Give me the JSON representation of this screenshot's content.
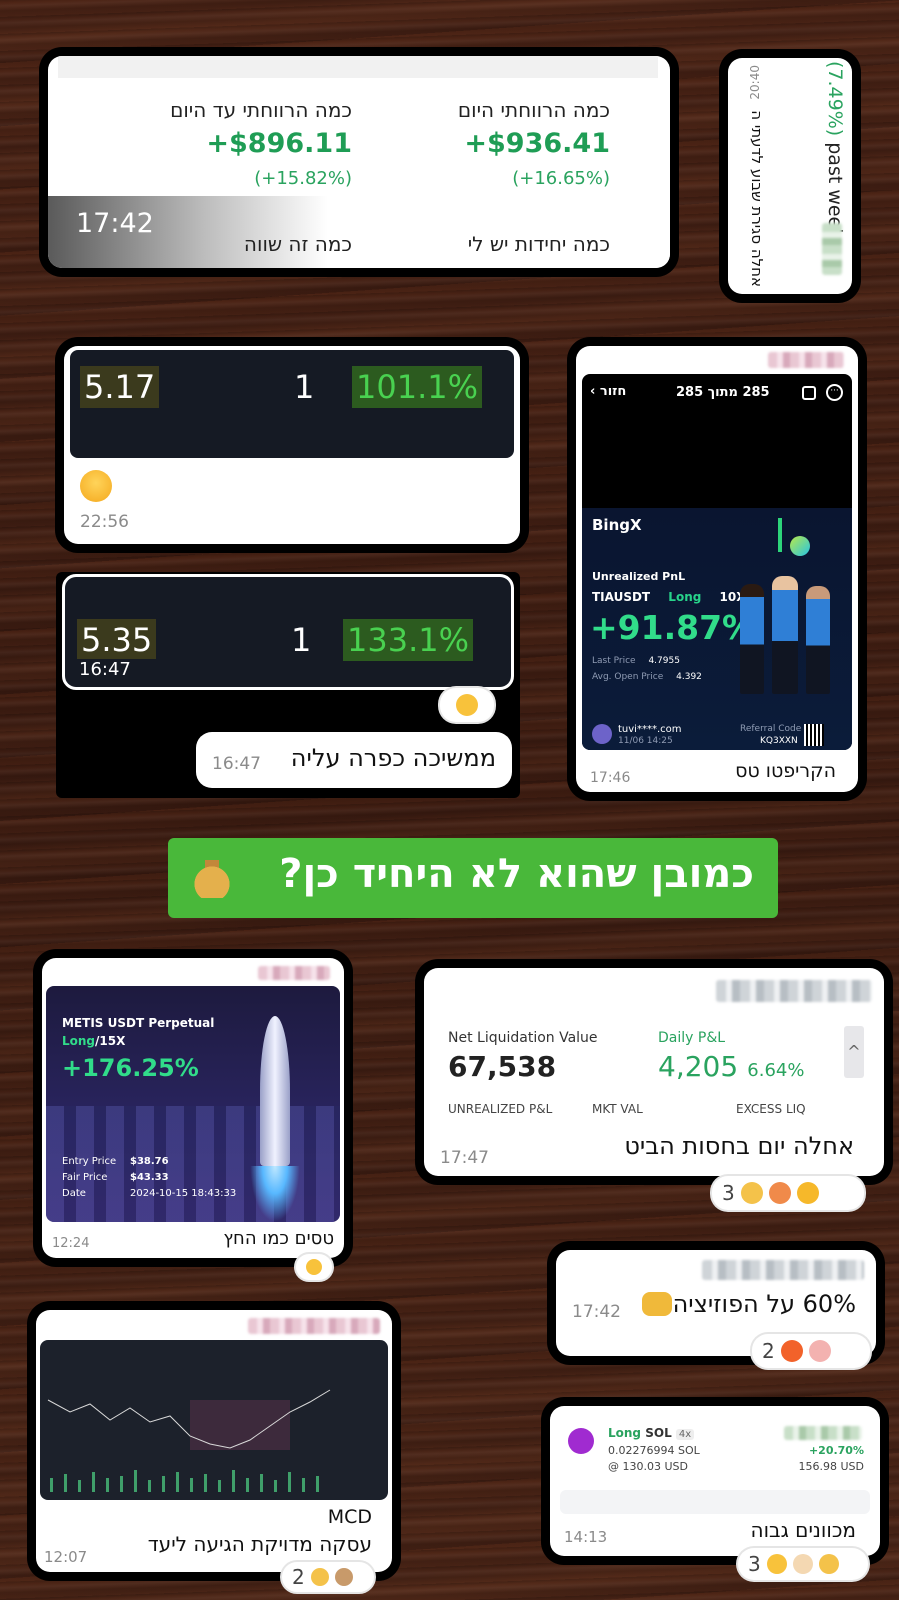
{
  "card1": {
    "profit_today_label": "כמה הרווחתי היום",
    "profit_today_value": "+$936.41",
    "profit_today_pct": "(+16.65%)",
    "profit_total_label": "כמה הרווחתי עד היום",
    "profit_total_value": "+$896.11",
    "profit_total_pct": "(+15.82%)",
    "units_label": "כמה יחידות יש לי",
    "worth_label": "כמה זה שווה",
    "time": "17:42"
  },
  "card_week": {
    "pct_text": "(7.49%)",
    "past_week": "past week",
    "caption": "אחלה סגירת שבוע לדעתי ה",
    "time": "20:40"
  },
  "row_a": {
    "left": "5.17",
    "mid": "1",
    "right": "101.1%",
    "time": "22:56"
  },
  "row_b": {
    "left": "5.35",
    "mid": "1",
    "right": "133.1%",
    "row_time": "16:47"
  },
  "msg_kapara": {
    "text": "ממשיכה כפרה עליה",
    "time": "16:47"
  },
  "bingx": {
    "back": "חזור",
    "counter": "285 מתוך 285",
    "logo": "BingX",
    "unrealized": "Unrealized PnL",
    "pair": "TIAUSDT",
    "side": "Long",
    "leverage": "10X",
    "pnl": "+91.87%",
    "last_price_label": "Last Price",
    "last_price": "4.7955",
    "avg_open_label": "Avg. Open Price",
    "avg_open": "4.392",
    "user": "tuvi****.com",
    "date": "11/06 14:25",
    "ref_label": "Referral Code",
    "ref_code": "KQ3XXN",
    "caption": "הקריפטו טס",
    "time": "17:46"
  },
  "banner": {
    "text": "כמובן שהוא לא היחיד כן?"
  },
  "metis": {
    "title": "METIS USDT Perpetual",
    "side": "Long",
    "leverage": "/15X",
    "pnl": "+176.25%",
    "entry_label": "Entry Price",
    "entry": "$38.76",
    "fair_label": "Fair Price",
    "fair": "$43.33",
    "date_label": "Date",
    "date": "2024-10-15 18:43:33",
    "caption": "טסים כמו החץ",
    "time": "12:24"
  },
  "liq": {
    "nlv_label": "Net Liquidation Value",
    "nlv": "67,538",
    "pnl_label": "Daily P&L",
    "pnl": "4,205",
    "pnl_pct": "6.64%",
    "col1": "UNREALIZED P&L",
    "col2": "MKT VAL",
    "col3": "EXCESS LIQ",
    "caption": "אחלה יום בחסות הביט",
    "time": "17:47",
    "reactions_count": "3"
  },
  "msg_60": {
    "text": "60% על הפוזיציה",
    "time": "17:42",
    "reactions_count": "2"
  },
  "mcd": {
    "line1": "MCD",
    "line2": "עסקה מדויקת הגיעה ליעד",
    "time": "12:07",
    "reactions_count": "2"
  },
  "sol": {
    "side": "Long",
    "asset": "SOL",
    "lev": "4x",
    "amount": "0.02276994 SOL",
    "price": "@ 130.03 USD",
    "pct": "+20.70%",
    "value": "156.98 USD",
    "caption": "מכוונים גבוה",
    "time": "14:13",
    "reactions_count": "3"
  }
}
